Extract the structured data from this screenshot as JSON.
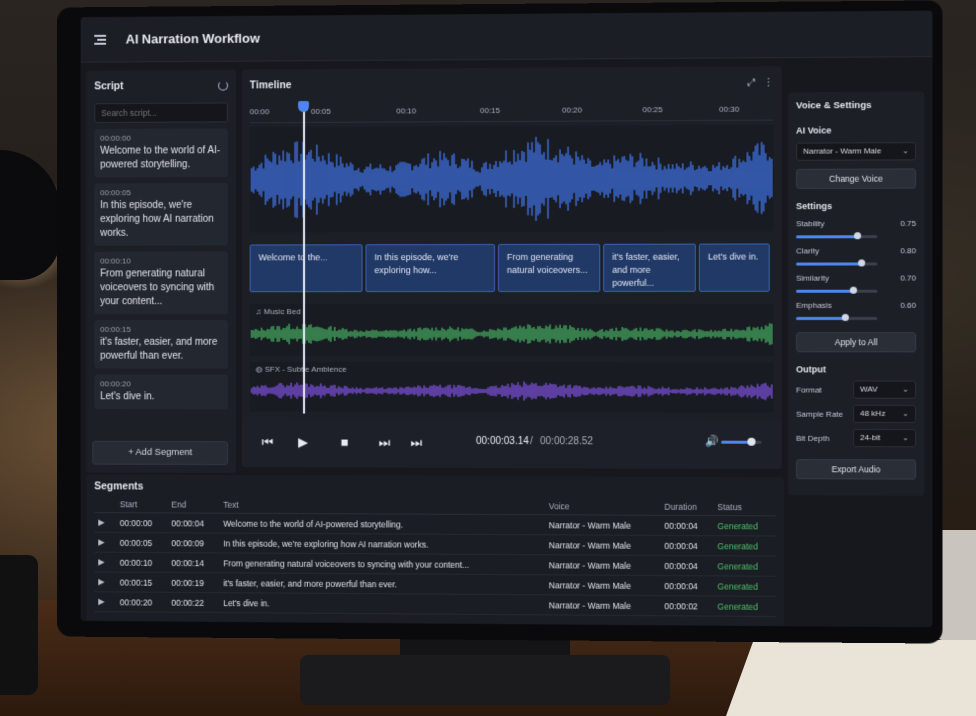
{
  "app": {
    "title": "AI Narration Workflow"
  },
  "script": {
    "title": "Script",
    "search_placeholder": "Search script...",
    "items": [
      {
        "time": "00:00:00",
        "text": "Welcome to the world of AI-powered storytelling."
      },
      {
        "time": "00:00:05",
        "text": "In this episode, we're exploring how AI narration works."
      },
      {
        "time": "00:00:10",
        "text": "From generating natural voiceovers to syncing with your content..."
      },
      {
        "time": "00:00:15",
        "text": "it's faster, easier, and more powerful than ever."
      },
      {
        "time": "00:00:20",
        "text": "Let's dive in."
      }
    ],
    "add_label": "+ Add Segment"
  },
  "timeline": {
    "title": "Timeline",
    "ticks": [
      "00:00",
      "00:05",
      "00:10",
      "00:15",
      "00:20",
      "00:25",
      "00:30"
    ],
    "clips": [
      "Welcome to the...",
      "In this episode, we're exploring how...",
      "From generating natural voiceovers...",
      "it's faster, easier, and more powerful...",
      "Let's dive in."
    ],
    "music_label": "Music Bed",
    "sfx_label": "SFX - Subtle Ambience",
    "colors": {
      "voice": "#3f6fe0",
      "music": "#45a860",
      "sfx": "#7a4fd8"
    }
  },
  "transport": {
    "current": "00:00:03.14",
    "separator": "/",
    "total": "00:00:28.52",
    "volume": 0.75
  },
  "settings": {
    "title": "Voice & Settings",
    "voice_label": "AI Voice",
    "voice_value": "Narrator - Warm Male",
    "change_voice": "Change Voice",
    "settings_label": "Settings",
    "sliders": [
      {
        "name": "Stability",
        "value": "0.75",
        "level": 0.75
      },
      {
        "name": "Clarity",
        "value": "0.80",
        "level": 0.8
      },
      {
        "name": "Similarity",
        "value": "0.70",
        "level": 0.7
      },
      {
        "name": "Emphasis",
        "value": "0.60",
        "level": 0.6
      }
    ],
    "apply_all": "Apply to All",
    "output_label": "Output",
    "format_label": "Format",
    "format_value": "WAV",
    "sample_label": "Sample Rate",
    "sample_value": "48 kHz",
    "bit_label": "Bit Depth",
    "bit_value": "24-bit",
    "export": "Export Audio"
  },
  "segments": {
    "title": "Segments",
    "headers": [
      "",
      "Start",
      "End",
      "Text",
      "Voice",
      "Duration",
      "Status"
    ],
    "rows": [
      [
        "00:00:00",
        "00:00:04",
        "Welcome to the world of AI-powered storytelling.",
        "Narrator - Warm Male",
        "00:00:04",
        "Generated"
      ],
      [
        "00:00:05",
        "00:00:09",
        "In this episode, we're exploring how AI narration works.",
        "Narrator - Warm Male",
        "00:00:04",
        "Generated"
      ],
      [
        "00:00:10",
        "00:00:14",
        "From generating natural voiceovers to syncing with your content...",
        "Narrator - Warm Male",
        "00:00:04",
        "Generated"
      ],
      [
        "00:00:15",
        "00:00:19",
        "it's faster, easier, and more powerful than ever.",
        "Narrator - Warm Male",
        "00:00:04",
        "Generated"
      ],
      [
        "00:00:20",
        "00:00:22",
        "Let's dive in.",
        "Narrator - Warm Male",
        "00:00:02",
        "Generated"
      ]
    ]
  }
}
